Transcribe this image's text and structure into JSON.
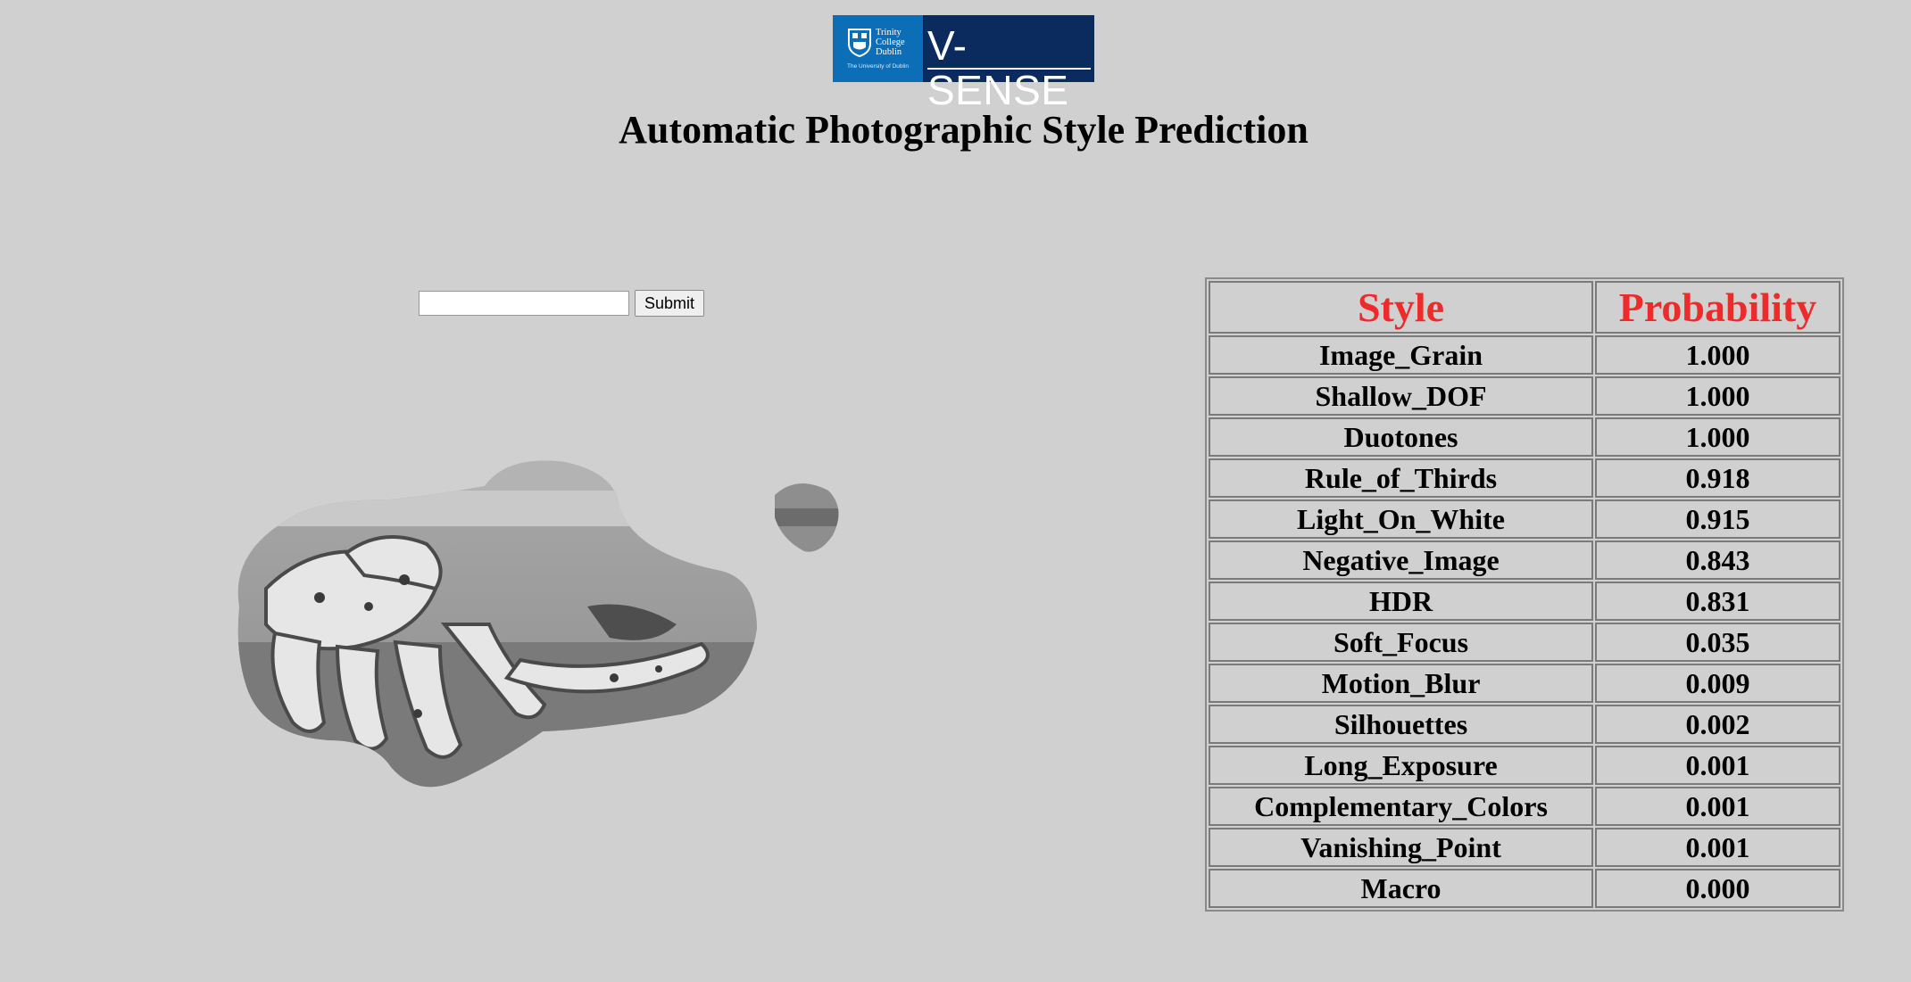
{
  "logo": {
    "institution_lines": [
      "Trinity",
      "College",
      "Dublin"
    ],
    "tagline": "The University of Dublin",
    "brand": "V-SENSE",
    "colors": {
      "left": "#0b6eb6",
      "right": "#0b2b5f"
    }
  },
  "page_title": "Automatic Photographic Style Prediction",
  "form": {
    "file_input_value": "",
    "submit_label": "Submit"
  },
  "image": {
    "subject": "grayscale photo of a crab on sand, shown through irregular blob-shaped masks"
  },
  "table": {
    "headers": [
      "Style",
      "Probability"
    ],
    "header_color": "#ee2b2b",
    "rows": [
      {
        "style": "Image_Grain",
        "probability": "1.000"
      },
      {
        "style": "Shallow_DOF",
        "probability": "1.000"
      },
      {
        "style": "Duotones",
        "probability": "1.000"
      },
      {
        "style": "Rule_of_Thirds",
        "probability": "0.918"
      },
      {
        "style": "Light_On_White",
        "probability": "0.915"
      },
      {
        "style": "Negative_Image",
        "probability": "0.843"
      },
      {
        "style": "HDR",
        "probability": "0.831"
      },
      {
        "style": "Soft_Focus",
        "probability": "0.035"
      },
      {
        "style": "Motion_Blur",
        "probability": "0.009"
      },
      {
        "style": "Silhouettes",
        "probability": "0.002"
      },
      {
        "style": "Long_Exposure",
        "probability": "0.001"
      },
      {
        "style": "Complementary_Colors",
        "probability": "0.001"
      },
      {
        "style": "Vanishing_Point",
        "probability": "0.001"
      },
      {
        "style": "Macro",
        "probability": "0.000"
      }
    ]
  }
}
